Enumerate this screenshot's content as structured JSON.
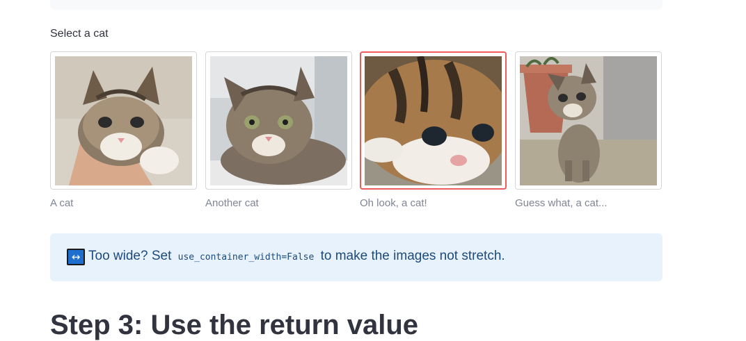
{
  "image_select": {
    "label": "Select a cat",
    "selected_index": 2,
    "options": [
      {
        "caption": "A cat"
      },
      {
        "caption": "Another cat"
      },
      {
        "caption": "Oh look, a cat!"
      },
      {
        "caption": "Guess what, a cat..."
      }
    ]
  },
  "info_box": {
    "icon": "↔",
    "icon_name": "left-right-arrow-icon",
    "text_before": "Too wide? Set ",
    "code": "use_container_width=False",
    "text_after": " to make the images not stretch."
  },
  "next_section": {
    "heading": "Step 3: Use the return value"
  },
  "colors": {
    "selected_border": "#ef5b5b",
    "info_background": "#e8f2fc",
    "info_text": "#1c4a7c"
  }
}
